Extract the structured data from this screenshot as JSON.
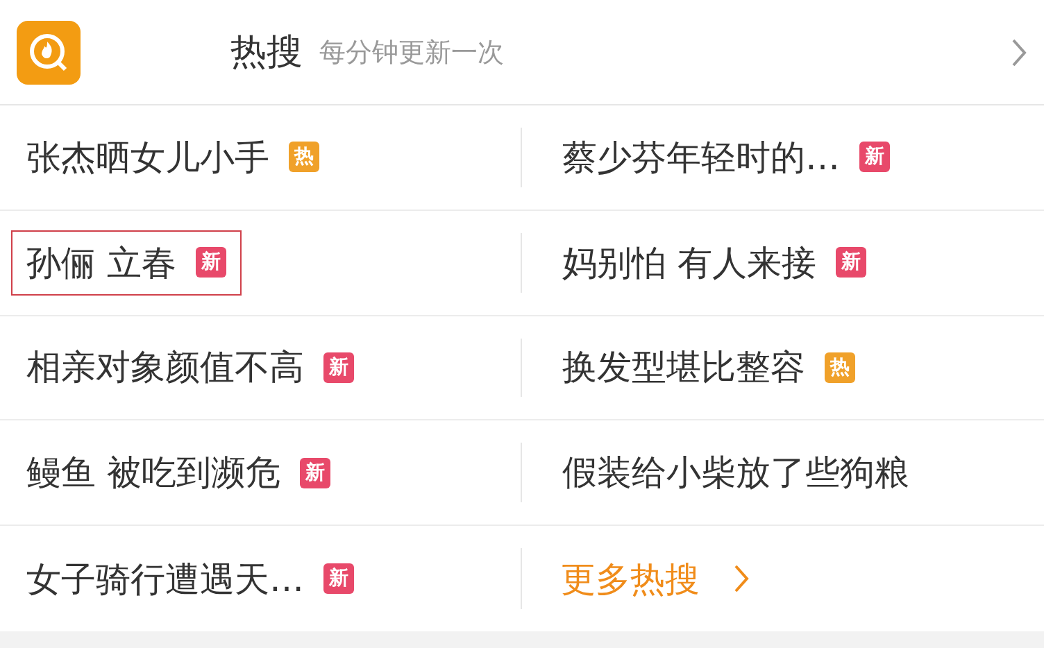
{
  "header": {
    "title": "热搜",
    "subtitle": "每分钟更新一次"
  },
  "items": [
    {
      "text": "张杰晒女儿小手",
      "badge": "热",
      "color": "#f0a12a",
      "highlighted": false
    },
    {
      "text": "蔡少芬年轻时的…",
      "badge": "新",
      "color": "#e8496a",
      "highlighted": false
    },
    {
      "text": "孙俪 立春",
      "badge": "新",
      "color": "#e8496a",
      "highlighted": true
    },
    {
      "text": "妈别怕 有人来接",
      "badge": "新",
      "color": "#e8496a",
      "highlighted": false
    },
    {
      "text": "相亲对象颜值不高",
      "badge": "新",
      "color": "#e8496a",
      "highlighted": false
    },
    {
      "text": "换发型堪比整容",
      "badge": "热",
      "color": "#f0a12a",
      "highlighted": false
    },
    {
      "text": "鳗鱼 被吃到濒危",
      "badge": "新",
      "color": "#e8496a",
      "highlighted": false
    },
    {
      "text": "假装给小柴放了些狗粮",
      "highlighted": false
    },
    {
      "text": "女子骑行遭遇天…",
      "badge": "新",
      "color": "#e8496a",
      "highlighted": false
    }
  ],
  "more": {
    "label": "更多热搜"
  }
}
